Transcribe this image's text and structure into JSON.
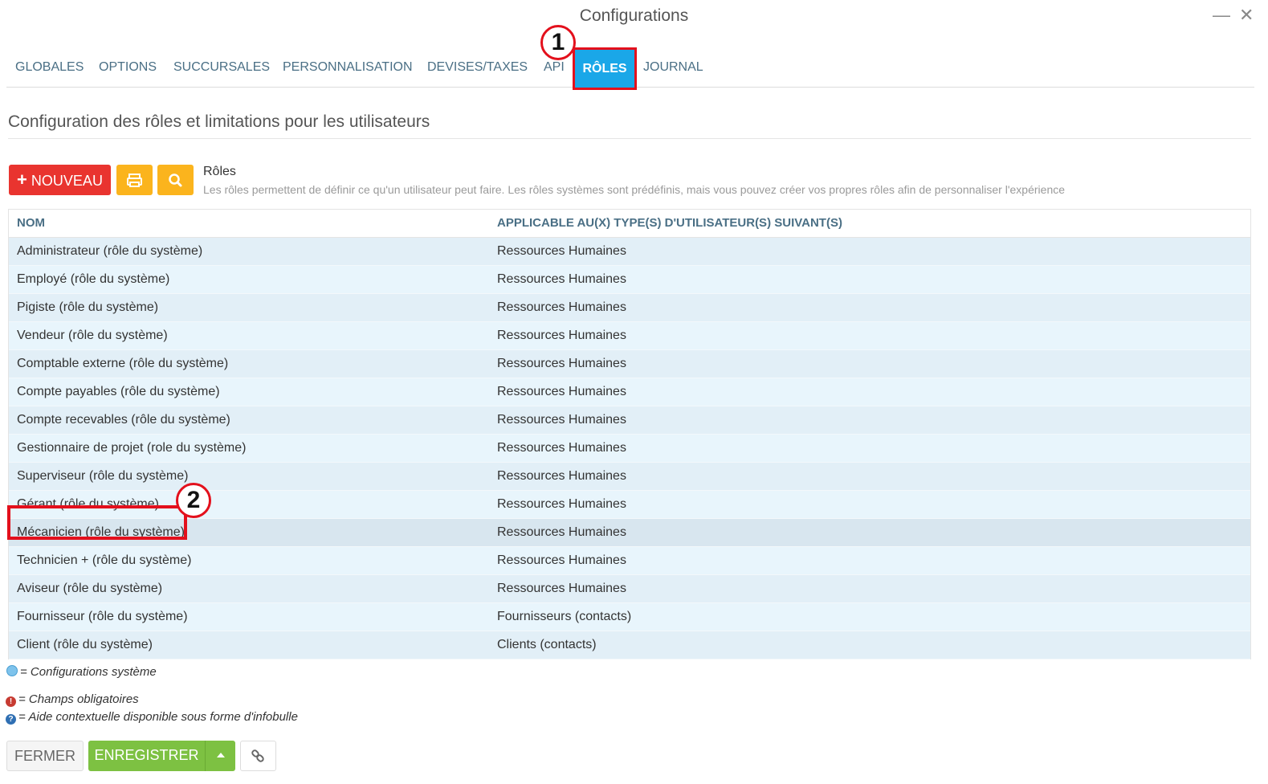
{
  "window": {
    "title": "Configurations",
    "minimize": "—",
    "close": "✕"
  },
  "tabs": [
    {
      "label": "GLOBALES"
    },
    {
      "label": "OPTIONS"
    },
    {
      "label": "SUCCURSALES"
    },
    {
      "label": "PERSONNALISATION"
    },
    {
      "label": "DEVISES/TAXES"
    },
    {
      "label": "API"
    },
    {
      "label": "RÔLES",
      "active": true
    },
    {
      "label": "JOURNAL"
    }
  ],
  "annotations": {
    "badge1": "1",
    "badge2": "2"
  },
  "page": {
    "title": "Configuration des rôles et limitations pour les utilisateurs"
  },
  "toolbar": {
    "new_label": "NOUVEAU",
    "new_icon": "+",
    "print_icon": "print-icon",
    "search_icon": "search-icon"
  },
  "section": {
    "title": "Rôles",
    "description": "Les rôles permettent de définir ce qu'un utilisateur peut faire. Les rôles systèmes sont prédéfinis, mais vous pouvez créer vos propres rôles afin de personnaliser l'expérience"
  },
  "table": {
    "headers": [
      "NOM",
      "APPLICABLE AU(X) TYPE(S) D'UTILISATEUR(S) SUIVANT(S)"
    ],
    "rows": [
      {
        "name": "Administrateur (rôle du système)",
        "type": "Ressources Humaines"
      },
      {
        "name": "Employé (rôle du système)",
        "type": "Ressources Humaines"
      },
      {
        "name": "Pigiste (rôle du système)",
        "type": "Ressources Humaines"
      },
      {
        "name": "Vendeur (rôle du système)",
        "type": "Ressources Humaines"
      },
      {
        "name": "Comptable externe (rôle du système)",
        "type": "Ressources Humaines"
      },
      {
        "name": "Compte payables (rôle du système)",
        "type": "Ressources Humaines"
      },
      {
        "name": "Compte recevables (rôle du système)",
        "type": "Ressources Humaines"
      },
      {
        "name": "Gestionnaire de projet (role du système)",
        "type": "Ressources Humaines"
      },
      {
        "name": "Superviseur (rôle du système)",
        "type": "Ressources Humaines"
      },
      {
        "name": "Gérant (rôle du système)",
        "type": "Ressources Humaines"
      },
      {
        "name": "Mécanicien (rôle du système)",
        "type": "Ressources Humaines",
        "highlighted": true
      },
      {
        "name": "Technicien + (rôle du système)",
        "type": "Ressources Humaines"
      },
      {
        "name": "Aviseur (rôle du système)",
        "type": "Ressources Humaines"
      },
      {
        "name": "Fournisseur (rôle du système)",
        "type": "Fournisseurs (contacts)"
      },
      {
        "name": "Client (rôle du système)",
        "type": "Clients (contacts)"
      }
    ]
  },
  "legend": {
    "system": "= Configurations système",
    "required": "= Champs obligatoires",
    "help": "= Aide contextuelle disponible sous forme d'infobulle",
    "required_glyph": "!",
    "help_glyph": "?"
  },
  "footer": {
    "close_label": "FERMER",
    "save_label": "ENREGISTRER",
    "dropdown_icon": "caret-up-icon",
    "link_icon": "link-icon"
  },
  "colors": {
    "accent": "#1aa7e8",
    "danger": "#e9342f",
    "warning": "#fbb41d",
    "success": "#7dc142",
    "annotation": "#e3101c"
  }
}
